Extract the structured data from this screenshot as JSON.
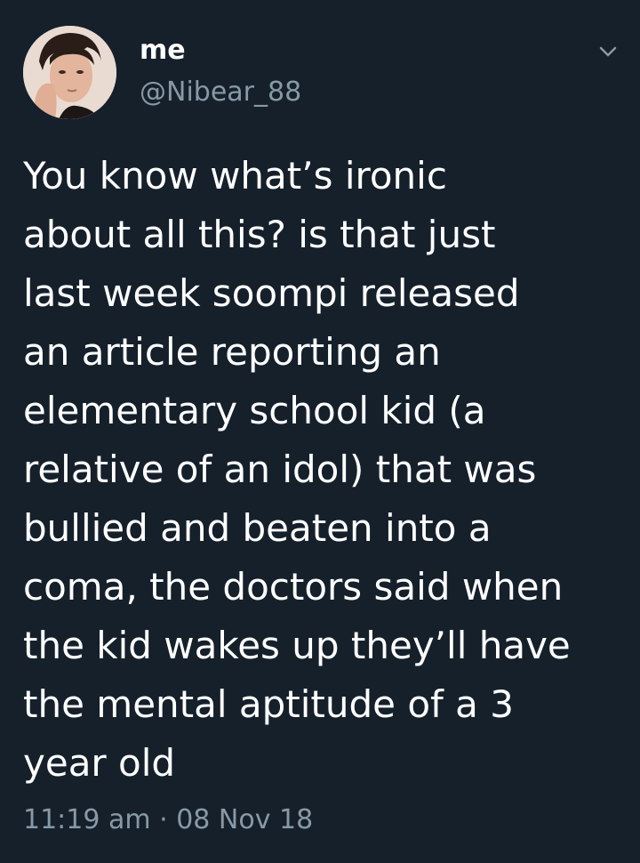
{
  "tweet": {
    "display_name": "me",
    "handle": "@Nibear_88",
    "text_lines": [
      "You know what’s ironic",
      "about all this? is that just",
      "last week soompi released",
      "an article reporting an",
      "elementary school kid (a",
      "relative of an idol) that was",
      "bullied and beaten into a",
      "coma, the doctors said when",
      "the kid wakes up they’ll have",
      "the mental aptitude of a 3",
      "year old"
    ],
    "timestamp": "11:19 am · 08 Nov 18"
  },
  "icons": {
    "menu": "chevron-down-icon",
    "avatar": "avatar"
  },
  "colors": {
    "background": "#15202b",
    "primary_text": "#ffffff",
    "secondary_text": "#8899a6"
  }
}
